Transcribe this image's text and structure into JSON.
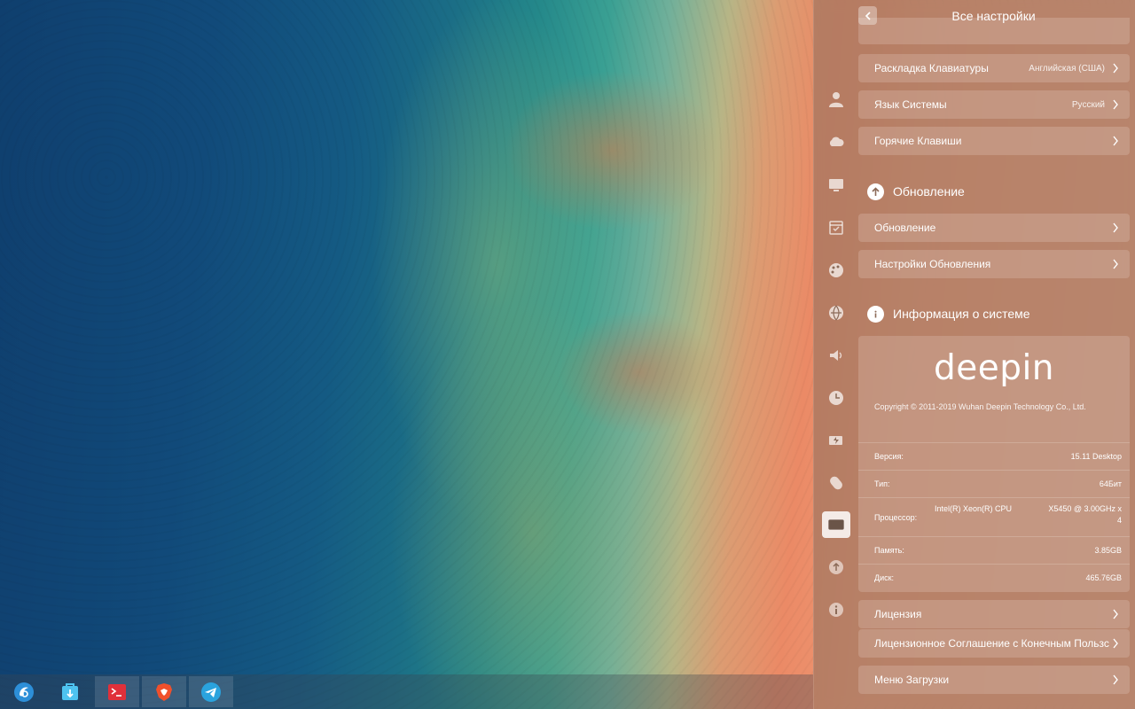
{
  "panel": {
    "title": "Все настройки",
    "rows_top": [
      {
        "label": "Раскладка Клавиатуры",
        "value": "Английская (США)"
      },
      {
        "label": "Язык Системы",
        "value": "Русский"
      },
      {
        "label": "Горячие Клавиши",
        "value": ""
      }
    ],
    "update_section": {
      "title": "Обновление",
      "rows": [
        {
          "label": "Обновление"
        },
        {
          "label": "Настройки Обновления"
        }
      ]
    },
    "system_info": {
      "title": "Информация о системе",
      "logo_text": "deepin",
      "copyright": "Copyright © 2011-2019 Wuhan Deepin Technology Co., Ltd.",
      "version_key": "Версия:",
      "version_val": "15.11 Desktop",
      "type_key": "Тип:",
      "type_val": "64Бит",
      "cpu_key": "Процессор:",
      "cpu_val_a": "Intel(R) Xeon(R) CPU",
      "cpu_val_b": "X5450  @ 3.00GHz x",
      "cpu_val_c": "4",
      "memory_key": "Память:",
      "memory_val": "3.85GB",
      "disk_key": "Диск:",
      "disk_val": "465.76GB"
    },
    "rows_bottom": [
      {
        "label": "Лицензия"
      },
      {
        "label": "Лицензионное Соглашение с Конечным Пользс"
      },
      {
        "label": "Меню Загрузки"
      }
    ],
    "rail_icons": [
      "user-icon",
      "cloud-icon",
      "display-icon",
      "calendar-icon",
      "personalization-icon",
      "network-icon",
      "sound-icon",
      "clock-icon",
      "power-icon",
      "mouse-icon",
      "keyboard-icon",
      "update-icon",
      "info-icon"
    ]
  },
  "dock": {
    "apps": [
      "launcher-icon",
      "app-store-icon",
      "terminal-icon",
      "brave-browser-icon",
      "telegram-icon"
    ]
  },
  "colors": {
    "panel_bg": "#96735f",
    "active_rail": "#ffffff"
  }
}
